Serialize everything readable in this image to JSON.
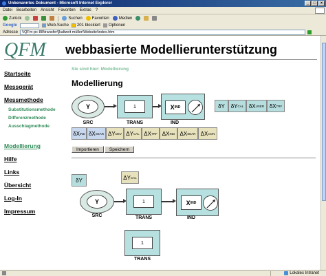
{
  "window": {
    "title": "Unbenanntes Dokument - Microsoft Internet Explorer",
    "controls": [
      "_",
      "□",
      "×"
    ]
  },
  "menu": [
    "Datei",
    "Bearbeiten",
    "Ansicht",
    "Favoriten",
    "Extras",
    "?"
  ],
  "toolbar": {
    "back": "Zurück",
    "search": "Suchen",
    "favorites": "Favoriten",
    "media": "Medien"
  },
  "googlebar": {
    "logo": "Google",
    "web_search": "Web-Suche",
    "blocked": "201 blockiert",
    "options": "Optionen"
  },
  "address": {
    "label": "Adresse",
    "url": "\\\\QFm-pc-88\\transfer\\[kaltzeit müller\\Website\\index.htm",
    "go": "Wechseln zu"
  },
  "site": {
    "title": "webbasierte Modellierunterstützung",
    "logo": "QFM"
  },
  "nav": {
    "items": [
      {
        "label": "Startseite"
      },
      {
        "label": "Messgerät"
      },
      {
        "label": "Messmethode"
      },
      {
        "label": "Modellierung"
      },
      {
        "label": "Hilfe"
      },
      {
        "label": "Links"
      },
      {
        "label": "Übersicht"
      },
      {
        "label": "Log-In"
      },
      {
        "label": "Impressum"
      }
    ],
    "subitems": [
      "Substitutionsmethode",
      "Differenzmethode",
      "Ausschlagmethode"
    ]
  },
  "breadcrumb": "Sie sind hier: Modellierung",
  "heading": "Modellierung",
  "diagram1": {
    "src_symbol": "Y",
    "src_label": "SRC",
    "trans_value": "1",
    "trans_label": "TRANS",
    "ind_symbol": "X",
    "ind_sub": "IND",
    "ind_label": "IND",
    "vars_row1": [
      {
        "sym": "δY",
        "sub": ""
      },
      {
        "sym": "δY",
        "sub": "CAL"
      },
      {
        "sym": "δX",
        "sub": "USER"
      },
      {
        "sym": "δX",
        "sub": "TRF"
      }
    ],
    "vars_row2": [
      {
        "sym": "δX",
        "sub": "IND"
      },
      {
        "sym": "δX",
        "sub": "SEAR"
      },
      {
        "sym": "ΔY",
        "sub": "DEV"
      },
      {
        "sym": "ΔY",
        "sub": "CAL"
      },
      {
        "sym": "ΔX",
        "sub": "TRF"
      },
      {
        "sym": "ΔX",
        "sub": "IND"
      },
      {
        "sym": "ΔX",
        "sub": "SEAR"
      },
      {
        "sym": "ΔX",
        "sub": "CON"
      }
    ]
  },
  "buttons": {
    "import": "Importieren",
    "save": "Speichern"
  },
  "diagram2": {
    "var_a": "δY",
    "var_b_sym": "ΔY",
    "var_b_sub": "CAL",
    "src_symbol": "Y",
    "src_label": "SRC",
    "trans_value": "1",
    "trans_label": "TRANS",
    "ind_symbol": "X",
    "ind_sub": "IND",
    "ind_label": "IND",
    "trans2_value": "1",
    "trans2_label": "TRANS"
  },
  "status": {
    "zone": "Lokales Intranet"
  }
}
